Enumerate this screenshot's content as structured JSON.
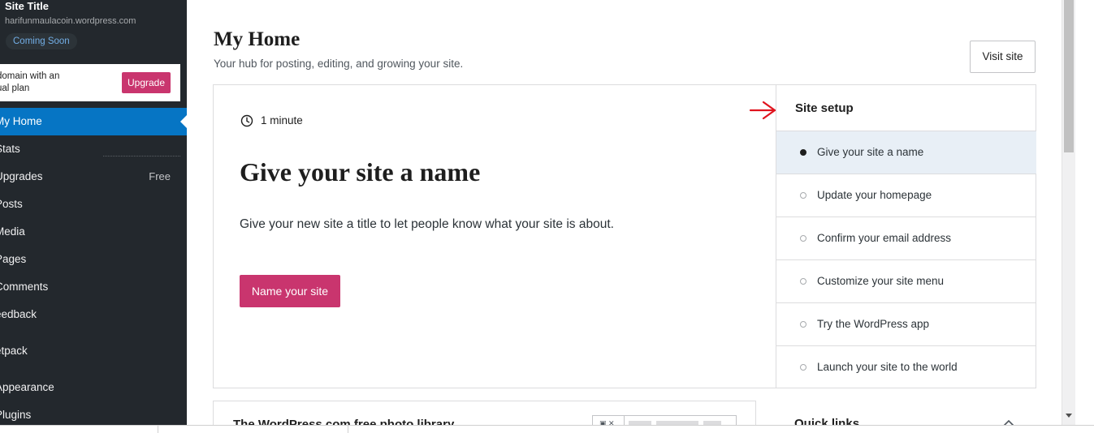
{
  "sidebar": {
    "site_title": "Site Title",
    "site_url": "harifunmaulacoin.wordpress.com",
    "status_badge": "Coming Soon",
    "upgrade_card": {
      "text_line1": "domain with an",
      "text_line2": "ual plan",
      "button_label": "Upgrade"
    },
    "items": [
      {
        "label": "My Home"
      },
      {
        "label": "Stats"
      },
      {
        "label": "Upgrades",
        "badge": "Free"
      },
      {
        "label": "Posts"
      },
      {
        "label": "Media"
      },
      {
        "label": "Pages"
      },
      {
        "label": "Comments"
      },
      {
        "label": "eedback"
      },
      {
        "label": "etpack"
      },
      {
        "label": "Appearance"
      },
      {
        "label": "Plugins"
      }
    ]
  },
  "header": {
    "title": "My Home",
    "subtitle": "Your hub for posting, editing, and growing your site.",
    "visit_site_label": "Visit site"
  },
  "task": {
    "time": "1 minute",
    "title": "Give your site a name",
    "description": "Give your new site a title to let people know what your site is about.",
    "button_label": "Name your site"
  },
  "checklist": {
    "title": "Site setup",
    "items": [
      {
        "label": "Give your site a name",
        "active": true
      },
      {
        "label": "Update your homepage",
        "active": false
      },
      {
        "label": "Confirm your email address",
        "active": false
      },
      {
        "label": "Customize your site menu",
        "active": false
      },
      {
        "label": "Try the WordPress app",
        "active": false
      },
      {
        "label": "Launch your site to the world",
        "active": false
      }
    ]
  },
  "cards": {
    "photo_library_title": "The WordPress.com free photo library",
    "quick_links_title": "Quick links"
  },
  "colors": {
    "sidebar_bg": "#23282d",
    "active_nav": "#0675c4",
    "primary_button": "#c9356e",
    "annotation_arrow": "#e0141e"
  },
  "icons": [
    "clock-icon",
    "red-arrow-icon",
    "chevron-up-icon",
    "image-icon",
    "scroll-down-arrow-icon"
  ]
}
